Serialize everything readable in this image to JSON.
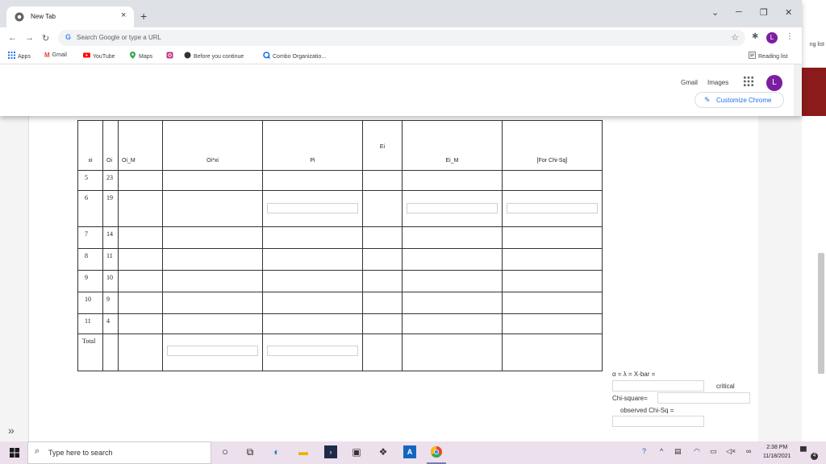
{
  "browser": {
    "tab_title": "New Tab",
    "tab_close": "×",
    "new_tab": "+",
    "omnibox_placeholder": "Search Google or type a URL",
    "bookmarks": [
      {
        "label": "Apps",
        "icon": "apps-grid-icon"
      },
      {
        "label": "Gmail",
        "icon": "gmail-icon"
      },
      {
        "label": "YouTube",
        "icon": "youtube-icon"
      },
      {
        "label": "Maps",
        "icon": "maps-pin-icon"
      },
      {
        "label": "",
        "icon": "instagram-icon"
      },
      {
        "label": "Before you continue",
        "icon": "dark-circle-icon"
      },
      {
        "label": "Combo Organizatio...",
        "icon": "q-icon"
      }
    ],
    "reading_list": "Reading list",
    "avatar_letter": "L",
    "accent_color": "#1a73e8"
  },
  "ntp": {
    "gmail": "Gmail",
    "images": "Images",
    "avatar_letter": "L",
    "customize": "Customize Chrome"
  },
  "background": {
    "side_text": "ng list",
    "expand": "»"
  },
  "table": {
    "headers": {
      "xi": "xi",
      "oi": "Oi",
      "oi_m": "Oi_M",
      "oixi": "Oi*xi",
      "pi": "Pi",
      "ei": "Ei",
      "ei_m": "Ei_M",
      "chi": "[For Chi-Sq]"
    },
    "rows": [
      {
        "xi": "5",
        "oi": "23"
      },
      {
        "xi": "6",
        "oi": "19"
      },
      {
        "xi": "7",
        "oi": "14"
      },
      {
        "xi": "8",
        "oi": "11"
      },
      {
        "xi": "9",
        "oi": "10"
      },
      {
        "xi": "10",
        "oi": "9"
      },
      {
        "xi": "11",
        "oi": "4"
      }
    ],
    "total_label": "Total"
  },
  "panel": {
    "alpha_label": "α = λ = X-bar =",
    "critical_label": "critical",
    "chisq_label": "Chi-square=",
    "observed_label": "observed Chi-Sq ="
  },
  "taskbar": {
    "search_placeholder": "Type here to search",
    "time": "2:38 PM",
    "date": "11/18/2021",
    "notif_count": "4"
  }
}
